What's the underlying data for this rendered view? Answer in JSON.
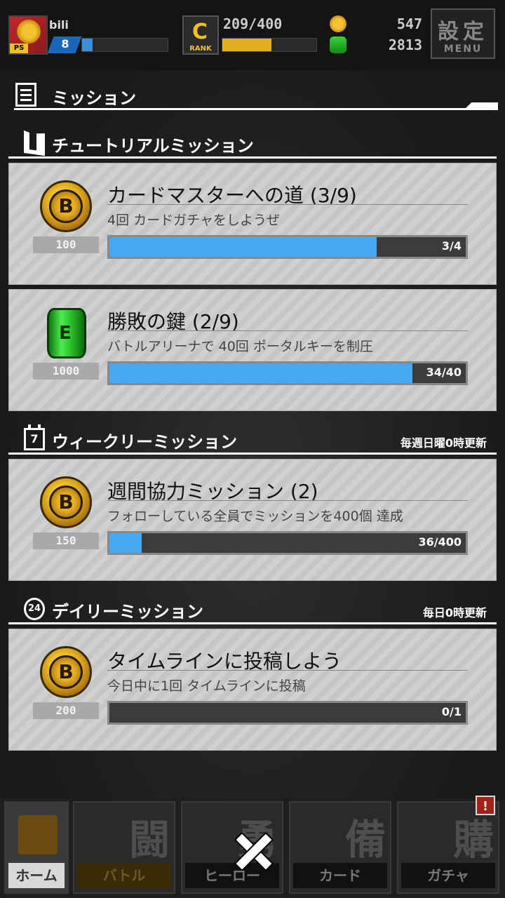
{
  "player": {
    "name": "bili",
    "level": "8",
    "exp_fraction": 0.12,
    "ps_tag": "PS"
  },
  "rank": {
    "label": "RANK",
    "glyph": "C",
    "value": "209/400",
    "fraction": 0.52
  },
  "currency": {
    "coins": "547",
    "keys": "2813"
  },
  "settings": {
    "kanji": "設定",
    "menu_label": "MENU"
  },
  "panel": {
    "title": "ミッション"
  },
  "sections": {
    "tutorial": {
      "title": "チュートリアルミッション"
    },
    "weekly": {
      "title": "ウィークリーミッション",
      "note": "毎週日曜0時更新",
      "icon_label": "7"
    },
    "daily": {
      "title": "デイリーミッション",
      "note": "毎日0時更新",
      "icon_label": "24"
    }
  },
  "missions": [
    {
      "reward_type": "coin",
      "reward_amount": "100",
      "title": "カードマスターへの道 (3/9)",
      "desc": "4回 カードガチャをしようぜ",
      "progress_text": "3/4",
      "progress": 0.75
    },
    {
      "reward_type": "key",
      "reward_amount": "1000",
      "title": "勝敗の鍵 (2/9)",
      "desc": "バトルアリーナで 40回 ポータルキーを制圧",
      "progress_text": "34/40",
      "progress": 0.85
    },
    {
      "reward_type": "coin",
      "reward_amount": "150",
      "title": "週間協力ミッション (2)",
      "desc": "フォローしている全員でミッションを400個 達成",
      "progress_text": "36/400",
      "progress": 0.09
    },
    {
      "reward_type": "coin",
      "reward_amount": "200",
      "title": "タイムラインに投稿しよう",
      "desc": "今日中に1回 タイムラインに投稿",
      "progress_text": "0/1",
      "progress": 0
    }
  ],
  "nav": {
    "home": "ホーム",
    "battle": {
      "label": "バトル",
      "kanji": "闘"
    },
    "hero": {
      "label": "ヒーロー",
      "kanji": "勇"
    },
    "card": {
      "label": "カード",
      "kanji": "備"
    },
    "gacha": {
      "label": "ガチャ",
      "kanji": "購"
    },
    "badge": "!"
  },
  "colors": {
    "progress_fill": "#46a8f0",
    "rank_fill": "#e0b020",
    "exp_fill": "#3a8fd8"
  }
}
